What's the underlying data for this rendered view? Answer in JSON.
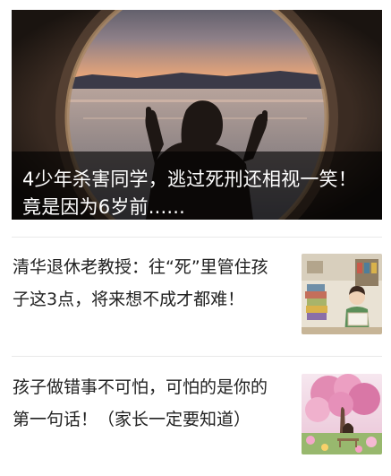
{
  "feed": {
    "hero": {
      "title": "4少年杀害同学，逃过死刑还相视一笑！竟是因为6岁前......"
    },
    "items": [
      {
        "title": "清华退休老教授：往“死”里管住孩子这3点，将来想不成才都难！"
      },
      {
        "title": "孩子做错事不可怕，可怕的是你的第一句话！（家长一定要知道）"
      }
    ]
  },
  "colors": {
    "caption_overlay": "#000000",
    "hero_title": "#ffffff",
    "item_title": "#222222",
    "divider": "#e9e9e9"
  }
}
